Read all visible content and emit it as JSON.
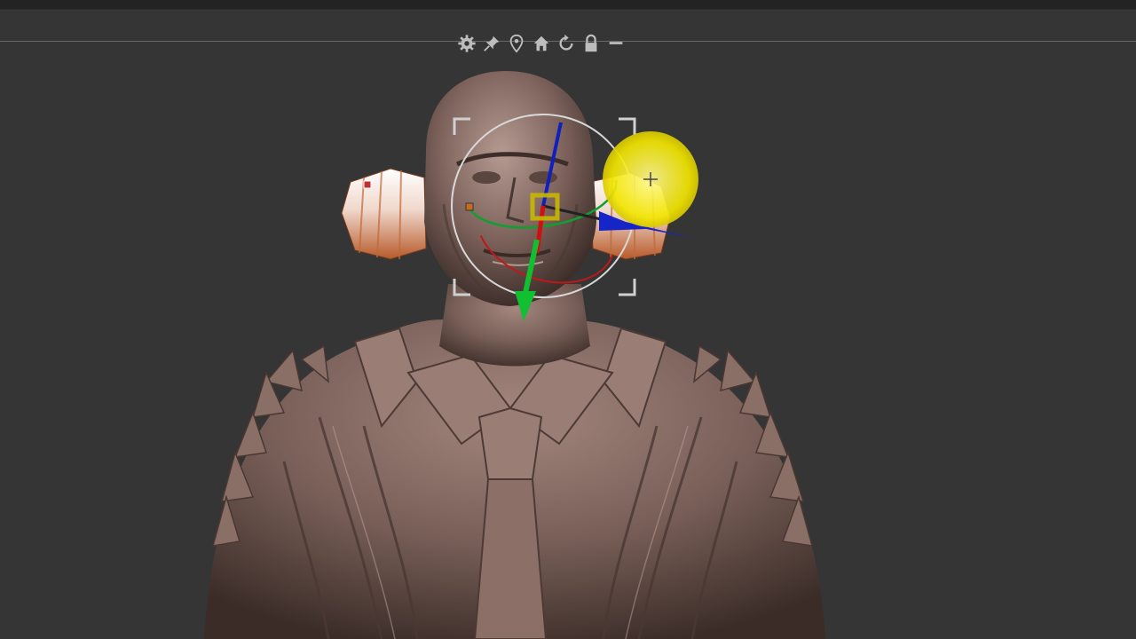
{
  "app": {
    "background_color": "#353535",
    "model_color": "#8a6a60",
    "highlight_color": "#f2e600"
  },
  "gizmo_toolbar": {
    "items": [
      {
        "icon": "gear-icon"
      },
      {
        "icon": "pin-icon"
      },
      {
        "icon": "location-pin-icon"
      },
      {
        "icon": "home-icon"
      },
      {
        "icon": "reset-icon"
      },
      {
        "icon": "lock-icon"
      },
      {
        "icon": "minus-icon"
      }
    ]
  },
  "gizmo": {
    "axis_colors": {
      "x": "#d01010",
      "y": "#10c030",
      "z": "#1020c0"
    }
  }
}
